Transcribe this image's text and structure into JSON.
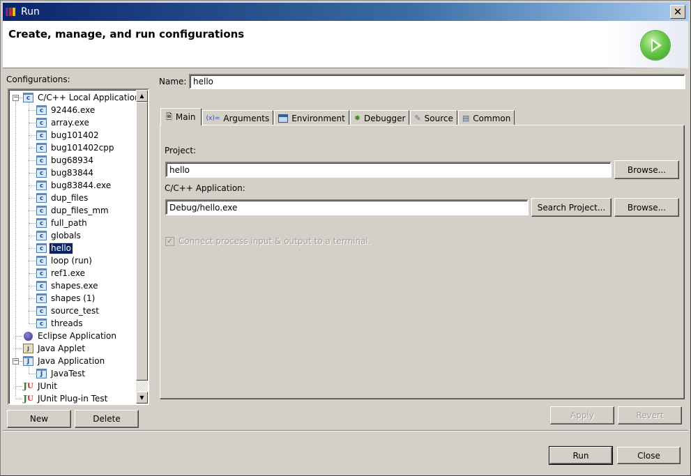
{
  "window": {
    "title": "Run",
    "close_label": "✕"
  },
  "banner": {
    "heading": "Create, manage, and run configurations",
    "icon": "run-play-icon"
  },
  "configurations": {
    "label": "Configurations:",
    "tree": [
      {
        "label": "C/C++ Local Application",
        "icon": "c-app-icon",
        "level": 0,
        "expanded": true
      },
      {
        "label": "92446.exe",
        "icon": "c-config-icon",
        "level": 1
      },
      {
        "label": "array.exe",
        "icon": "c-config-icon",
        "level": 1
      },
      {
        "label": "bug101402",
        "icon": "c-config-icon",
        "level": 1
      },
      {
        "label": "bug101402cpp",
        "icon": "c-config-icon",
        "level": 1
      },
      {
        "label": "bug68934",
        "icon": "c-config-icon",
        "level": 1
      },
      {
        "label": "bug83844",
        "icon": "c-config-icon",
        "level": 1
      },
      {
        "label": "bug83844.exe",
        "icon": "c-config-icon",
        "level": 1
      },
      {
        "label": "dup_files",
        "icon": "c-config-icon",
        "level": 1
      },
      {
        "label": "dup_files_mm",
        "icon": "c-config-icon",
        "level": 1
      },
      {
        "label": "full_path",
        "icon": "c-config-icon",
        "level": 1
      },
      {
        "label": "globals",
        "icon": "c-config-icon",
        "level": 1
      },
      {
        "label": "hello",
        "icon": "c-config-icon",
        "level": 1,
        "selected": true
      },
      {
        "label": "loop (run)",
        "icon": "c-config-icon",
        "level": 1
      },
      {
        "label": "ref1.exe",
        "icon": "c-config-icon",
        "level": 1
      },
      {
        "label": "shapes.exe",
        "icon": "c-config-icon",
        "level": 1
      },
      {
        "label": "shapes (1)",
        "icon": "c-config-icon",
        "level": 1
      },
      {
        "label": "source_test",
        "icon": "c-config-icon",
        "level": 1
      },
      {
        "label": "threads",
        "icon": "c-config-icon",
        "level": 1
      },
      {
        "label": "Eclipse Application",
        "icon": "eclipse-icon",
        "level": 0
      },
      {
        "label": "Java Applet",
        "icon": "java-applet-icon",
        "level": 0
      },
      {
        "label": "Java Application",
        "icon": "java-app-icon",
        "level": 0,
        "expanded": true
      },
      {
        "label": "JavaTest",
        "icon": "java-config-icon",
        "level": 1
      },
      {
        "label": "JUnit",
        "icon": "junit-icon",
        "level": 0
      },
      {
        "label": "JUnit Plug-in Test",
        "icon": "junit-plugin-icon",
        "level": 0
      }
    ],
    "new_label": "New",
    "delete_label": "Delete"
  },
  "editor": {
    "name_label": "Name:",
    "name_value": "hello",
    "tabs": [
      {
        "label": "Main",
        "icon": "page-icon",
        "active": true
      },
      {
        "label": "Arguments",
        "icon": "arguments-icon"
      },
      {
        "label": "Environment",
        "icon": "environment-icon"
      },
      {
        "label": "Debugger",
        "icon": "bug-icon"
      },
      {
        "label": "Source",
        "icon": "source-icon"
      },
      {
        "label": "Common",
        "icon": "table-icon"
      }
    ],
    "main": {
      "project_label": "Project:",
      "project_value": "hello",
      "browse_label": "Browse...",
      "application_label": "C/C++ Application:",
      "application_value": "Debug/hello.exe",
      "search_project_label": "Search Project...",
      "browse2_label": "Browse...",
      "terminal_checkbox_label": "Connect process input & output to a terminal.",
      "terminal_checked": true,
      "terminal_enabled": false
    },
    "apply_label": "Apply",
    "revert_label": "Revert"
  },
  "footer": {
    "run_label": "Run",
    "close_label": "Close"
  }
}
